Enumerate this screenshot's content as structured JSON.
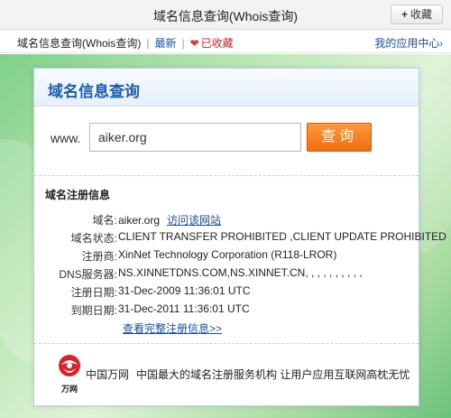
{
  "window": {
    "title": "域名信息查询(Whois查询)",
    "fav_button": "收藏",
    "fav_button_prefix": "+"
  },
  "nav": {
    "breadcrumb": "域名信息查询(Whois查询)",
    "separator": "|",
    "latest": "最新",
    "saved": "已收藏",
    "my_apps": "我的应用中心",
    "my_apps_arrow": "›"
  },
  "card": {
    "heading": "域名信息查询",
    "search": {
      "prefix": "www.",
      "value": "aiker.org",
      "button": "查询"
    },
    "info": {
      "title": "域名注册信息",
      "rows": [
        {
          "key": "域名:",
          "value": "aiker.org",
          "link": "访问该网站"
        },
        {
          "key": "域名状态:",
          "value": "CLIENT TRANSFER PROHIBITED ,CLIENT UPDATE PROHIBITED"
        },
        {
          "key": "注册商:",
          "value": "XinNet Technology Corporation (R118-LROR)"
        },
        {
          "key": "DNS服务器:",
          "value": "NS.XINNETDNS.COM,NS.XINNET.CN, , , , , , , , , ,"
        },
        {
          "key": "注册日期:",
          "value": "31-Dec-2009 11:36:01 UTC"
        },
        {
          "key": "到期日期:",
          "value": "31-Dec-2011 11:36:01 UTC"
        }
      ],
      "more_link": "查看完整注册信息>>"
    },
    "footer": {
      "brand": "中国万网",
      "slogan": "中国最大的域名注册服务机构 让用户应用互联网高枕无忧",
      "logo_text": "万网"
    }
  },
  "colors": {
    "heading_blue": "#1a5dae",
    "link_blue": "#1a4fa3",
    "search_button_orange": "#f06d12",
    "heart_red": "#e2353d",
    "logo_red": "#d8232a"
  }
}
